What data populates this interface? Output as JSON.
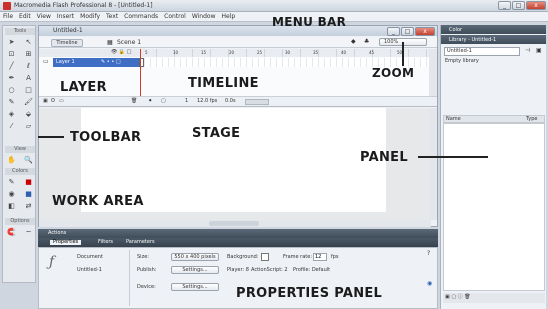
{
  "window": {
    "title": "Macromedia Flash Professional 8 - [Untitled-1]",
    "minimize": "_",
    "maximize": "□",
    "close": "x"
  },
  "menu": [
    "File",
    "Edit",
    "View",
    "Insert",
    "Modify",
    "Text",
    "Commands",
    "Control",
    "Window",
    "Help"
  ],
  "tools": {
    "header": "Tools",
    "view_label": "View",
    "colors_label": "Colors",
    "options_label": "Options"
  },
  "document": {
    "tab_title": "Untitled-1",
    "timeline_button": "Timeline",
    "scene": "Scene 1",
    "zoom": "100%",
    "layer_name": "Layer 1",
    "frame_numbers": [
      "5",
      "10",
      "15",
      "20",
      "25",
      "30",
      "35",
      "40",
      "45",
      "50"
    ],
    "timeline_frame": "1",
    "timeline_fps": "12.0 fps",
    "timeline_time": "0.0s"
  },
  "panels": {
    "color_title": "Color",
    "library_title": "Library - Untitled-1",
    "library_select": "Untitled-1",
    "library_empty": "Empty library",
    "col_name": "Name",
    "col_type": "Type"
  },
  "bottom": {
    "actions_title": "Actions",
    "tabs": [
      "Properties",
      "Filters",
      "Parameters"
    ],
    "document_label": "Document",
    "document_name": "Untitled-1",
    "size_label": "Size:",
    "size_value": "550 x 400 pixels",
    "background_label": "Background:",
    "frame_rate_label": "Frame rate:",
    "frame_rate_value": "12",
    "fps_unit": "fps",
    "publish_label": "Publish:",
    "settings_button": "Settings...",
    "player_text": "Player: 8",
    "actionscript_text": "ActionScript: 2",
    "profile_text": "Profile: Default",
    "device_label": "Device:",
    "device_settings_button": "Settings..."
  },
  "annotations": {
    "menu_bar": "MENU BAR",
    "zoom": "ZOOM",
    "layer": "LAYER",
    "timeline": "TIMELINE",
    "toolbar": "TOOLBAR",
    "stage": "STAGE",
    "panel": "PANEL",
    "work_area": "WORK AREA",
    "properties_panel": "PROPERTIES PANEL"
  },
  "colors": {
    "layer_highlight": "#3e6fc4",
    "panel_header": "#46535f",
    "close_button": "#c2412f"
  }
}
